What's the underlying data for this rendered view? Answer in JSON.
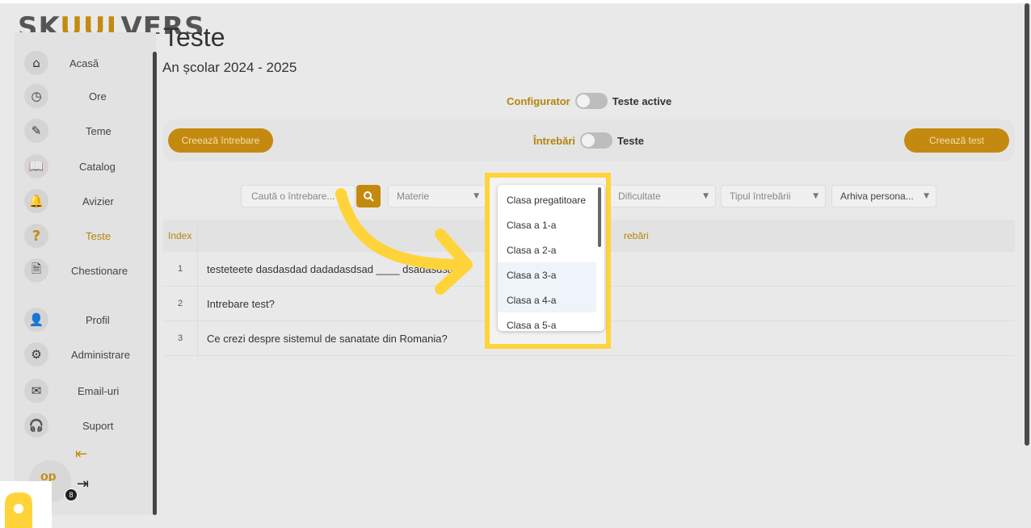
{
  "brand": {
    "logo_text_a": "SK",
    "logo_text_b": "UUL",
    "logo_text_c": "VERS"
  },
  "sidebar": {
    "items": [
      {
        "label": "Acasă",
        "icon": "home-icon",
        "glyph": "⌂"
      },
      {
        "label": "Ore",
        "icon": "clock-icon",
        "glyph": "◷"
      },
      {
        "label": "Teme",
        "icon": "pencil-icon",
        "glyph": "✎"
      },
      {
        "label": "Catalog",
        "icon": "book-icon",
        "glyph": "📖"
      },
      {
        "label": "Avizier",
        "icon": "bell-icon",
        "glyph": "🔔"
      },
      {
        "label": "Teste",
        "icon": "question-icon",
        "glyph": "?"
      },
      {
        "label": "Chestionare",
        "icon": "document-icon",
        "glyph": "🗎"
      },
      {
        "label": "Profil",
        "icon": "profile-icon",
        "glyph": "👤"
      },
      {
        "label": "Administrare",
        "icon": "gears-icon",
        "glyph": "⚙"
      },
      {
        "label": "Email-uri",
        "icon": "envelope-icon",
        "glyph": "✉"
      },
      {
        "label": "Suport",
        "icon": "headset-icon",
        "glyph": "🎧"
      }
    ],
    "collapse_glyph": "⇤",
    "logout_glyph": "⇥",
    "avatar_initials": "op",
    "notification_count": "8"
  },
  "header": {
    "title": "Teste",
    "subtitle": "An școlar 2024 - 2025"
  },
  "mode_toggle": {
    "left_label": "Configurator",
    "right_label": "Teste active"
  },
  "action_bar": {
    "create_question_label": "Creează întrebare",
    "toggle_left_label": "Întrebări",
    "toggle_right_label": "Teste",
    "create_test_label": "Creează test"
  },
  "filters": {
    "search_placeholder": "Caută o întrebare...",
    "subject": "Materie",
    "difficulty": "Dificultate",
    "question_type": "Tipul întrebării",
    "archive": "Arhiva persona..."
  },
  "grade_dropdown": {
    "options": [
      "Clasa pregatitoare",
      "Clasa a 1-a",
      "Clasa a 2-a",
      "Clasa a 3-a",
      "Clasa a 4-a",
      "Clasa a 5-a"
    ]
  },
  "table": {
    "headers": {
      "index": "Index",
      "question": "rebări"
    },
    "rows": [
      {
        "index": "1",
        "text": "testeteete dasdasdad dadadasdsad ____ dsadasdsa"
      },
      {
        "index": "2",
        "text": "Intrebare test?"
      },
      {
        "index": "3",
        "text": "Ce crezi despre sistemul de sanatate din Romania?"
      }
    ]
  },
  "colors": {
    "accent": "#c48a10",
    "highlight": "#ffd43b"
  }
}
